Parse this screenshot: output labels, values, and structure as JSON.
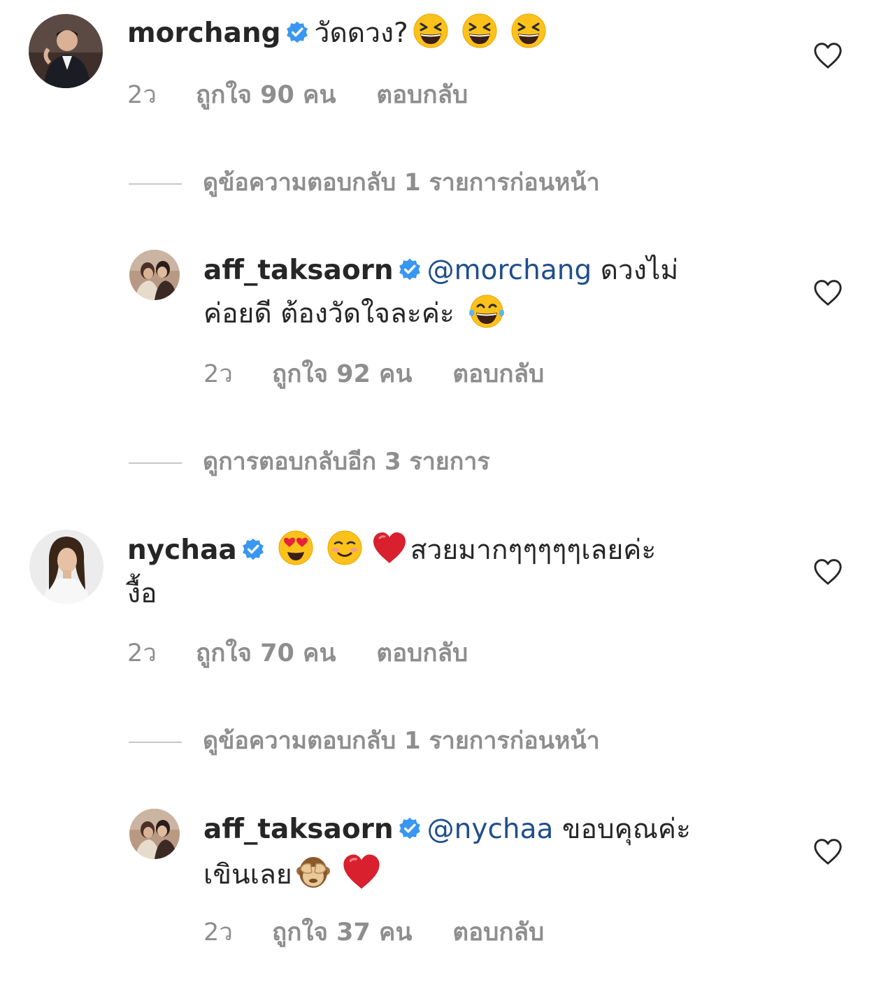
{
  "comments": [
    {
      "username": "morchang",
      "text": "วัดดวง?",
      "time": "2ว",
      "likes": "ถูกใจ 90 คน",
      "reply_label": "ตอบกลับ"
    },
    {
      "username": "aff_taksaorn",
      "mention": "@morchang",
      "text_line1": "ดวงไม่",
      "text_line2": "ค่อยดี ต้องวัดใจละค่ะ",
      "time": "2ว",
      "likes": "ถูกใจ 92 คน",
      "reply_label": "ตอบกลับ"
    },
    {
      "username": "nychaa",
      "text_line1": "สวยมากๆๆๆๆๆเลยค่ะ",
      "text_line2": "งื้อ",
      "time": "2ว",
      "likes": "ถูกใจ 70 คน",
      "reply_label": "ตอบกลับ"
    },
    {
      "username": "aff_taksaorn",
      "mention": "@nychaa",
      "text_line1": "ขอบคุณค่ะ",
      "text_line2": "เขินเลย",
      "time": "2ว",
      "likes": "ถูกใจ 37 คน",
      "reply_label": "ตอบกลับ"
    }
  ],
  "threads": {
    "view_previous_1": "ดูข้อความตอบกลับ 1 รายการก่อนหน้า",
    "view_more_3": "ดูการตอบกลับอีก 3 รายการ",
    "view_previous_2": "ดูข้อความตอบกลับ 1 รายการก่อนหน้า"
  },
  "icons": {
    "verified": "verified-badge-icon",
    "like": "heart-outline-icon",
    "emoji_laugh": "grinning-squinting-face-icon",
    "emoji_tears": "face-with-tears-of-joy-icon",
    "emoji_heart_eyes": "smiling-face-heart-eyes-icon",
    "emoji_blush": "smiling-face-icon",
    "emoji_heart": "red-heart-icon",
    "emoji_monkey": "see-no-evil-monkey-icon"
  },
  "colors": {
    "verified": "#3897f0",
    "mention": "#1f4e8c",
    "meta": "#8e8e8e"
  }
}
